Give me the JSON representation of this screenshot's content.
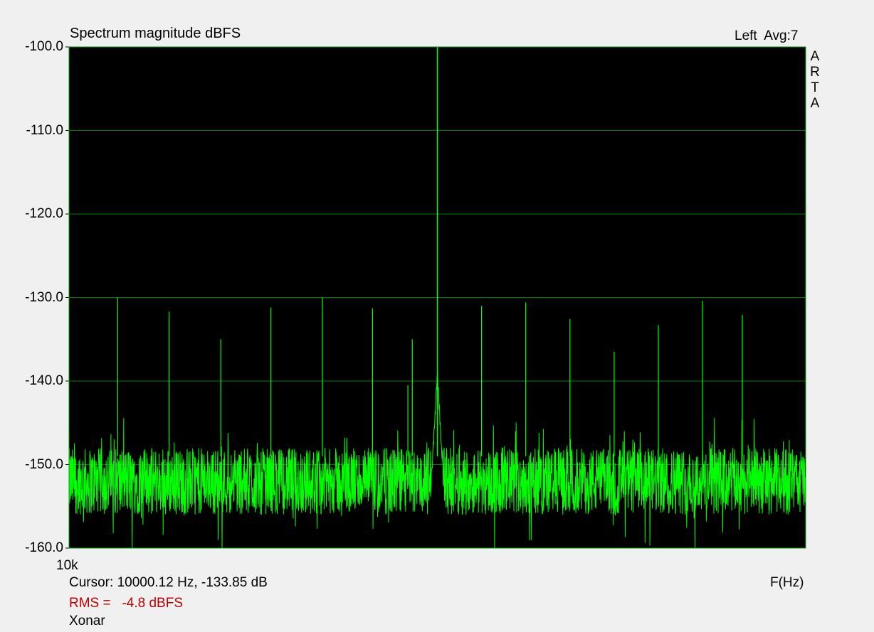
{
  "header": {
    "title": "Spectrum magnitude dBFS",
    "channel": "Left  Avg:7",
    "brand_vertical": "ARTA"
  },
  "footer": {
    "cursor": "Cursor: 10000.12 Hz, -133.85 dB",
    "xaxis_label": "F(Hz)",
    "rms_label": "RMS =",
    "rms_value": "-4.8 dBFS",
    "device": "Xonar"
  },
  "colors": {
    "background": "#f0f0f0",
    "plot_background": "#000000",
    "grid": "#008000",
    "trace": "#00ff00",
    "rms_text": "#c00000"
  },
  "chart_data": {
    "type": "line",
    "title": "Spectrum magnitude dBFS",
    "xlabel": "F(Hz)",
    "ylabel": "",
    "ylim": [
      -160,
      -100
    ],
    "xlim": [
      9975,
      10025
    ],
    "x_scale": "linear",
    "grid": true,
    "y_ticks": [
      "-100.0",
      "-110.0",
      "-120.0",
      "-130.0",
      "-140.0",
      "-150.0",
      "-160.0"
    ],
    "x_ticks": [
      {
        "value": 9975,
        "label": "10k"
      }
    ],
    "noise_floor_db": -152,
    "series": [
      {
        "peaks": [
          {
            "x": 10000.0,
            "y": -100.0
          },
          {
            "x": 9978.3,
            "y": -130.0
          },
          {
            "x": 9981.8,
            "y": -131.7
          },
          {
            "x": 9985.3,
            "y": -135.0
          },
          {
            "x": 9988.7,
            "y": -131.2
          },
          {
            "x": 9992.2,
            "y": -130.0
          },
          {
            "x": 9995.6,
            "y": -131.3
          },
          {
            "x": 9998.3,
            "y": -135.0
          },
          {
            "x": 9998.0,
            "y": -140.5
          },
          {
            "x": 10003.0,
            "y": -131.0
          },
          {
            "x": 10006.0,
            "y": -130.6
          },
          {
            "x": 10009.0,
            "y": -132.6
          },
          {
            "x": 10012.0,
            "y": -136.5
          },
          {
            "x": 10015.0,
            "y": -133.3
          },
          {
            "x": 10018.0,
            "y": -130.4
          },
          {
            "x": 10020.7,
            "y": -132.1
          }
        ]
      }
    ]
  }
}
